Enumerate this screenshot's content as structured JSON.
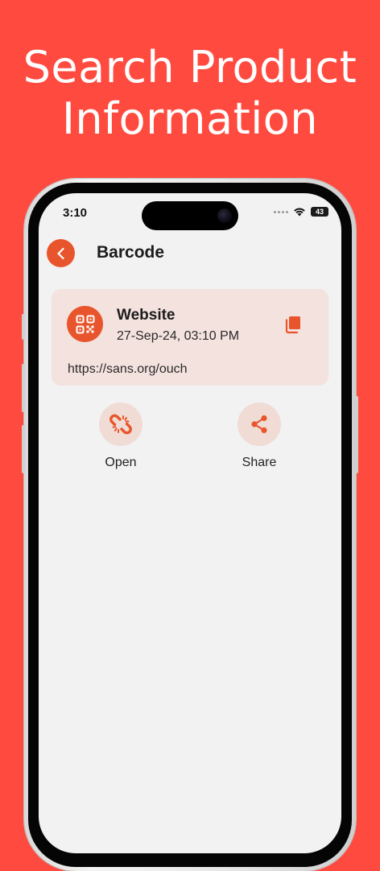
{
  "promo": {
    "line1": "Search Product",
    "line2": "Information"
  },
  "status_bar": {
    "time": "3:10",
    "battery": "43"
  },
  "header": {
    "title": "Barcode"
  },
  "result_card": {
    "type": "Website",
    "datetime": "27-Sep-24, 03:10 PM",
    "url": "https://sans.org/ouch"
  },
  "actions": [
    {
      "label": "Open",
      "icon": "broken-link-icon"
    },
    {
      "label": "Share",
      "icon": "share-icon"
    }
  ],
  "colors": {
    "background": "#ff4a3f",
    "accent": "#e8552c",
    "card_bg": "#f3e2dd",
    "screen_bg": "#f2f2f2"
  }
}
